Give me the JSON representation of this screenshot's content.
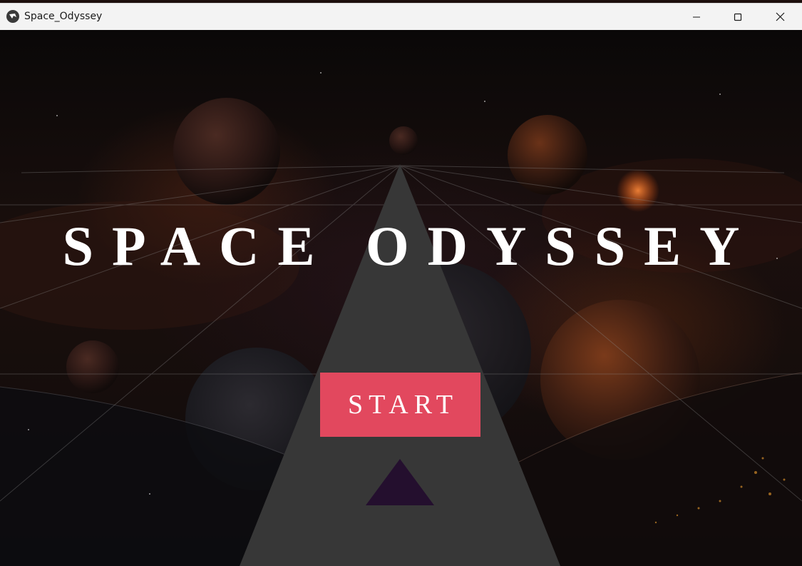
{
  "window": {
    "title": "Space_Odyssey",
    "icon": "kivy-app-icon",
    "controls": {
      "minimize": "minimize-icon",
      "maximize": "maximize-icon",
      "close": "close-icon"
    }
  },
  "screen": {
    "title": "SPACE ODYSSEY",
    "start_label": "START"
  },
  "colors": {
    "titlebar": "#f3f3f3",
    "triangle": "#373737",
    "start_button": "#e2485e",
    "small_triangle": "#240f2e",
    "title_text": "#ffffff"
  }
}
